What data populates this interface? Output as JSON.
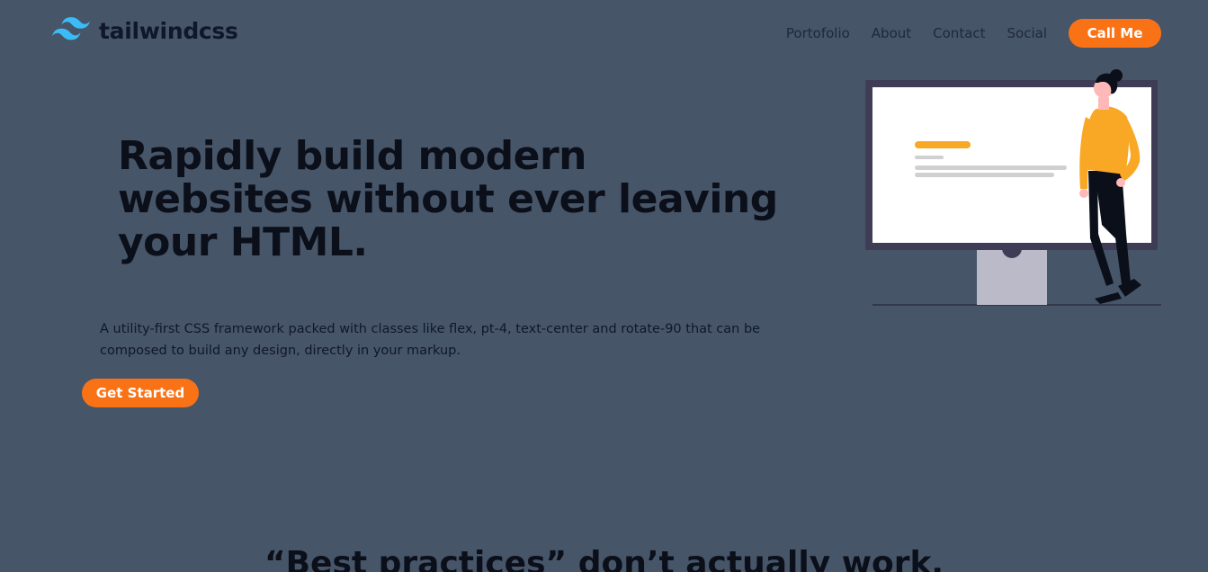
{
  "brand": {
    "name": "tailwindcss",
    "logo_icon": "tailwind-wave-icon",
    "logo_color": "#38bdf8"
  },
  "nav": {
    "links": [
      "Portofolio",
      "About",
      "Contact",
      "Social"
    ],
    "cta_label": "Call Me"
  },
  "hero": {
    "title": "Rapidly build modern websites without ever leaving your HTML.",
    "description": "A utility-first CSS framework packed with classes like flex, pt-4, text-center and rotate-90 that can be composed to build any design, directly in your markup.",
    "cta_label": "Get Started",
    "illustration": "person-with-monitor-illustration"
  },
  "section": {
    "title": "“Best practices” don’t actually work."
  },
  "colors": {
    "background": "#475569",
    "accent": "#f97316",
    "illustration_accent": "#f9a826"
  }
}
